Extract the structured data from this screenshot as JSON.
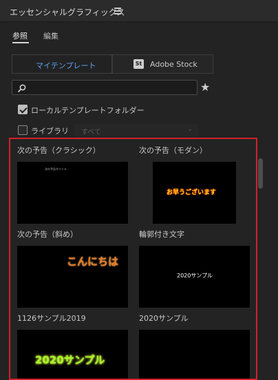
{
  "panel": {
    "title": "エッセンシャルグラフィックス",
    "menu_icon": "hamburger-icon"
  },
  "tabs": [
    {
      "label": "参照",
      "active": true
    },
    {
      "label": "編集",
      "active": false
    }
  ],
  "source_toggle": {
    "my_templates": "マイテンプレート",
    "adobe_stock": "Adobe Stock",
    "adobe_stock_badge": "St"
  },
  "search": {
    "value": "",
    "placeholder": "",
    "icon": "search-icon",
    "favorite_icon": "star-icon"
  },
  "filters": {
    "local_templates": {
      "label": "ローカルテンプレートフォルダー",
      "checked": true
    },
    "library": {
      "label": "ライブラリ",
      "checked": false,
      "dropdown_value": "すべて"
    }
  },
  "templates": [
    {
      "name": "次の予告（クラシック）",
      "thumb_text": "次の予告タイトル",
      "thumb_color": "#bbbbbb"
    },
    {
      "name": "次の予告（モダン）",
      "thumb_text": "お早うございます",
      "thumb_color": "#ff4a1a"
    },
    {
      "name": "次の予告（斜め）",
      "thumb_text": "こんにちは",
      "thumb_color": "#f07a22"
    },
    {
      "name": "輪郭付き文字",
      "thumb_text": "2020サンプル",
      "thumb_color": "#ffffff"
    },
    {
      "name": "1126サンプル2019",
      "thumb_text": "2020サンプル",
      "thumb_color": "#9cff2a"
    },
    {
      "name": "2020サンプル",
      "thumb_text": "",
      "thumb_color": "#ffffff"
    }
  ],
  "colors": {
    "accent_blue": "#5aa3f0",
    "highlight_border": "#d3202a"
  }
}
